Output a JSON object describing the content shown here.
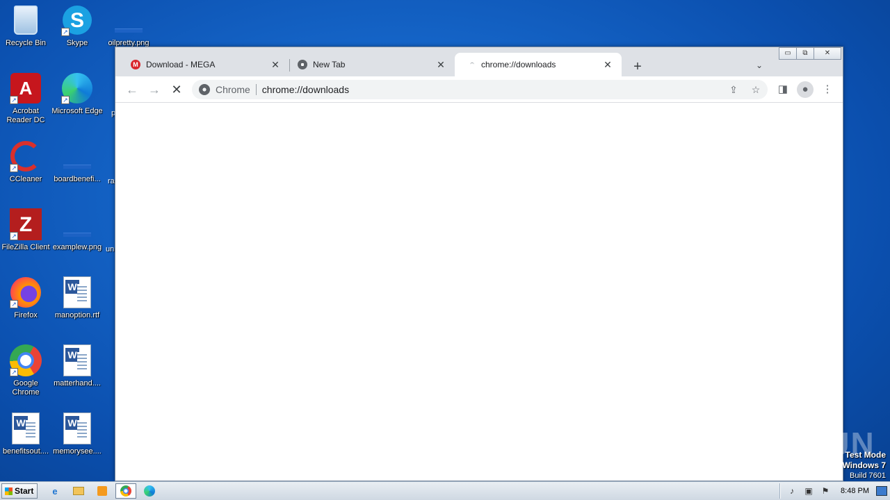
{
  "desktop": {
    "icons": [
      {
        "label": "Recycle Bin",
        "icon": "recycle-bin-icon"
      },
      {
        "label": "Skype",
        "icon": "skype-icon"
      },
      {
        "label": "oilpretty.png",
        "icon": "image-file-icon"
      },
      {
        "label": "Acrobat Reader DC",
        "icon": "acrobat-icon"
      },
      {
        "label": "Microsoft Edge",
        "icon": "edge-icon"
      },
      {
        "label": "CCleaner",
        "icon": "ccleaner-icon"
      },
      {
        "label": "boardbenefi...",
        "icon": "image-file-icon"
      },
      {
        "label": "FileZilla Client",
        "icon": "filezilla-icon"
      },
      {
        "label": "examplew.png",
        "icon": "image-file-icon"
      },
      {
        "label": "Firefox",
        "icon": "firefox-icon"
      },
      {
        "label": "manoption.rtf",
        "icon": "word-doc-icon"
      },
      {
        "label": "Google Chrome",
        "icon": "chrome-icon"
      },
      {
        "label": "matterhand....",
        "icon": "word-doc-icon"
      },
      {
        "label": "benefitsout....",
        "icon": "word-doc-icon"
      },
      {
        "label": "memorysee....",
        "icon": "word-doc-icon"
      }
    ],
    "partial_labels": [
      "p",
      "ra",
      "un"
    ]
  },
  "browser": {
    "tabs": [
      {
        "title": "Download - MEGA",
        "favicon": "mega-icon",
        "close": "✕",
        "active": false
      },
      {
        "title": "New Tab",
        "favicon": "chrome-icon",
        "close": "✕",
        "active": false
      },
      {
        "title": "chrome://downloads",
        "favicon": "loading-icon",
        "close": "✕",
        "active": true
      }
    ],
    "new_tab": "+",
    "tab_search": "⌄",
    "window_controls": {
      "minimize": "▭",
      "maximize": "⧉",
      "close": "✕"
    },
    "toolbar": {
      "back": "←",
      "forward": "→",
      "stop": "✕",
      "chip": "Chrome",
      "url": "chrome://downloads",
      "share": "⇪",
      "bookmark": "☆",
      "side_panel": "◨",
      "profile": "●",
      "menu": "⋮"
    }
  },
  "watermark": "ANY RUN",
  "test_mode": {
    "line1": "Test Mode",
    "line2": "Windows 7",
    "line3": "Build 7601"
  },
  "taskbar": {
    "start": "Start",
    "clock": "8:48 PM",
    "tray_icons": [
      "speaker-icon",
      "network-icon",
      "flag-icon"
    ]
  }
}
